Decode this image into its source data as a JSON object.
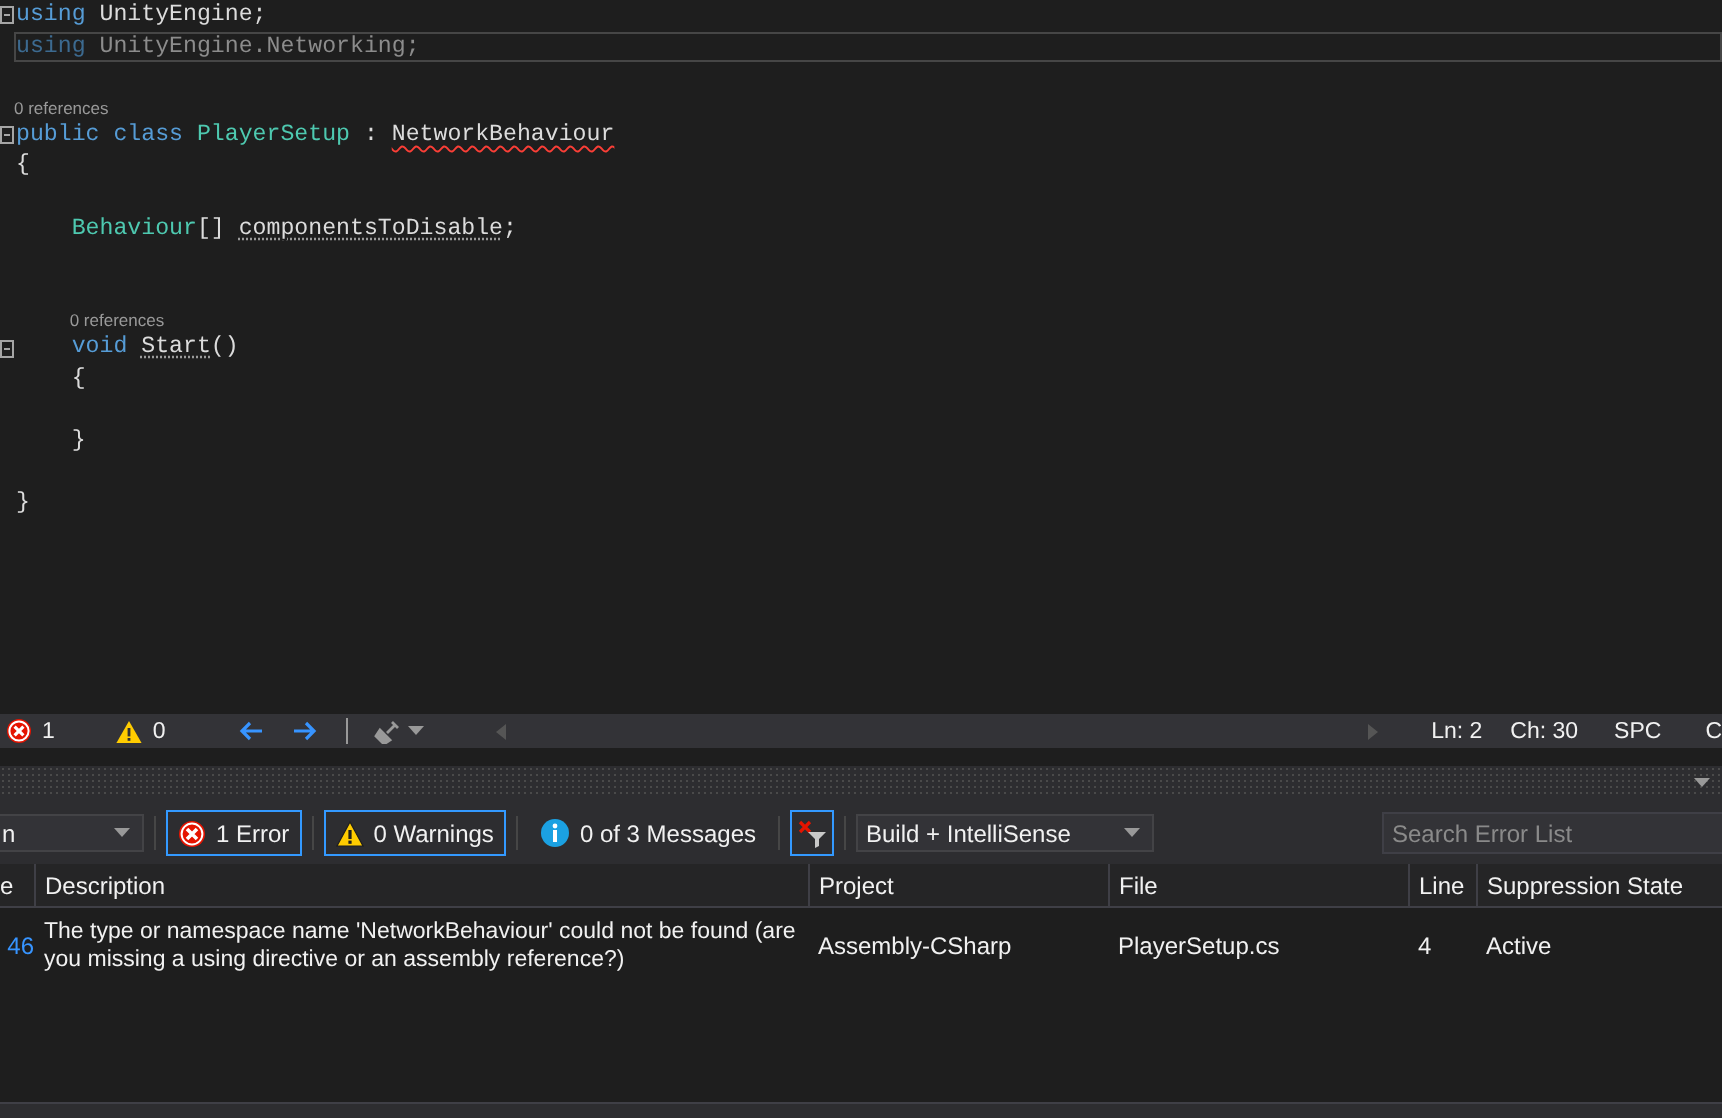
{
  "editor": {
    "lines": [
      {
        "kind": "code",
        "fold": true,
        "current": false,
        "tokens": [
          {
            "kind": "keyword",
            "text": "using",
            "squiggle": false,
            "dotted": false
          },
          {
            "kind": "plain",
            "text": " UnityEngine;",
            "squiggle": false,
            "dotted": false
          }
        ]
      },
      {
        "kind": "code",
        "fold": false,
        "current": true,
        "tokens": [
          {
            "kind": "dim-keyword",
            "text": "using",
            "squiggle": false,
            "dotted": false
          },
          {
            "kind": "dim",
            "text": " UnityEngine.Networking;",
            "squiggle": false,
            "dotted": false
          }
        ]
      },
      {
        "kind": "blank"
      },
      {
        "kind": "code",
        "fold": true,
        "current": false,
        "codelens": "0 references",
        "tokens": [
          {
            "kind": "keyword",
            "text": "public class ",
            "squiggle": false,
            "dotted": false
          },
          {
            "kind": "type",
            "text": "PlayerSetup",
            "squiggle": false,
            "dotted": false
          },
          {
            "kind": "plain",
            "text": " : ",
            "squiggle": false,
            "dotted": false
          },
          {
            "kind": "plain",
            "text": "NetworkBehaviour",
            "squiggle": true,
            "dotted": false
          }
        ]
      },
      {
        "kind": "code",
        "fold": false,
        "current": false,
        "tokens": [
          {
            "kind": "plain",
            "text": "{",
            "squiggle": false,
            "dotted": false
          }
        ]
      },
      {
        "kind": "blank"
      },
      {
        "kind": "code",
        "fold": false,
        "current": false,
        "tokens": [
          {
            "kind": "type",
            "text": "    Behaviour",
            "squiggle": false,
            "dotted": false
          },
          {
            "kind": "plain",
            "text": "[] ",
            "squiggle": false,
            "dotted": false
          },
          {
            "kind": "plain",
            "text": "componentsToDisable",
            "squiggle": false,
            "dotted": true
          },
          {
            "kind": "plain",
            "text": ";",
            "squiggle": false,
            "dotted": false
          }
        ]
      },
      {
        "kind": "blank"
      },
      {
        "kind": "blank"
      },
      {
        "kind": "code",
        "fold": true,
        "current": false,
        "codelens": "0 references",
        "tokens": [
          {
            "kind": "keyword",
            "text": "    void ",
            "squiggle": false,
            "dotted": false
          },
          {
            "kind": "plain",
            "text": "Start",
            "squiggle": false,
            "dotted": true
          },
          {
            "kind": "plain",
            "text": "()",
            "squiggle": false,
            "dotted": false
          }
        ]
      },
      {
        "kind": "code",
        "fold": false,
        "current": false,
        "tokens": [
          {
            "kind": "plain",
            "text": "    {",
            "squiggle": false,
            "dotted": false
          }
        ]
      },
      {
        "kind": "blank"
      },
      {
        "kind": "code",
        "fold": false,
        "current": false,
        "tokens": [
          {
            "kind": "plain",
            "text": "    }",
            "squiggle": false,
            "dotted": false
          }
        ]
      },
      {
        "kind": "blank"
      },
      {
        "kind": "code",
        "fold": false,
        "current": false,
        "tokens": [
          {
            "kind": "plain",
            "text": "}",
            "squiggle": false,
            "dotted": false
          }
        ]
      }
    ]
  },
  "status_bar": {
    "errors": "1",
    "warnings": "0",
    "line": "Ln: 2",
    "column": "Ch: 30",
    "indent_mode": "SPC",
    "column_5": "C"
  },
  "error_list": {
    "scope_dropdown": "n",
    "filters": [
      {
        "kind": "error",
        "label": "1 Error",
        "selected": true
      },
      {
        "kind": "warning",
        "label": "0 Warnings",
        "selected": true
      },
      {
        "kind": "info",
        "label": "0 of 3 Messages",
        "selected": false
      }
    ],
    "filter_toggle": {
      "selected": true
    },
    "source_dropdown": "Build + IntelliSense",
    "search": {
      "placeholder": "Search Error List"
    },
    "columns": [
      "e",
      "Description",
      "Project",
      "File",
      "Line",
      "Suppression State"
    ],
    "rows": [
      {
        "cells": [
          "46",
          "The type or namespace name 'NetworkBehaviour' could not be found (are you missing a using directive or an assembly reference?)",
          "Assembly-CSharp",
          "PlayerSetup.cs",
          "4",
          "Active"
        ]
      }
    ]
  }
}
